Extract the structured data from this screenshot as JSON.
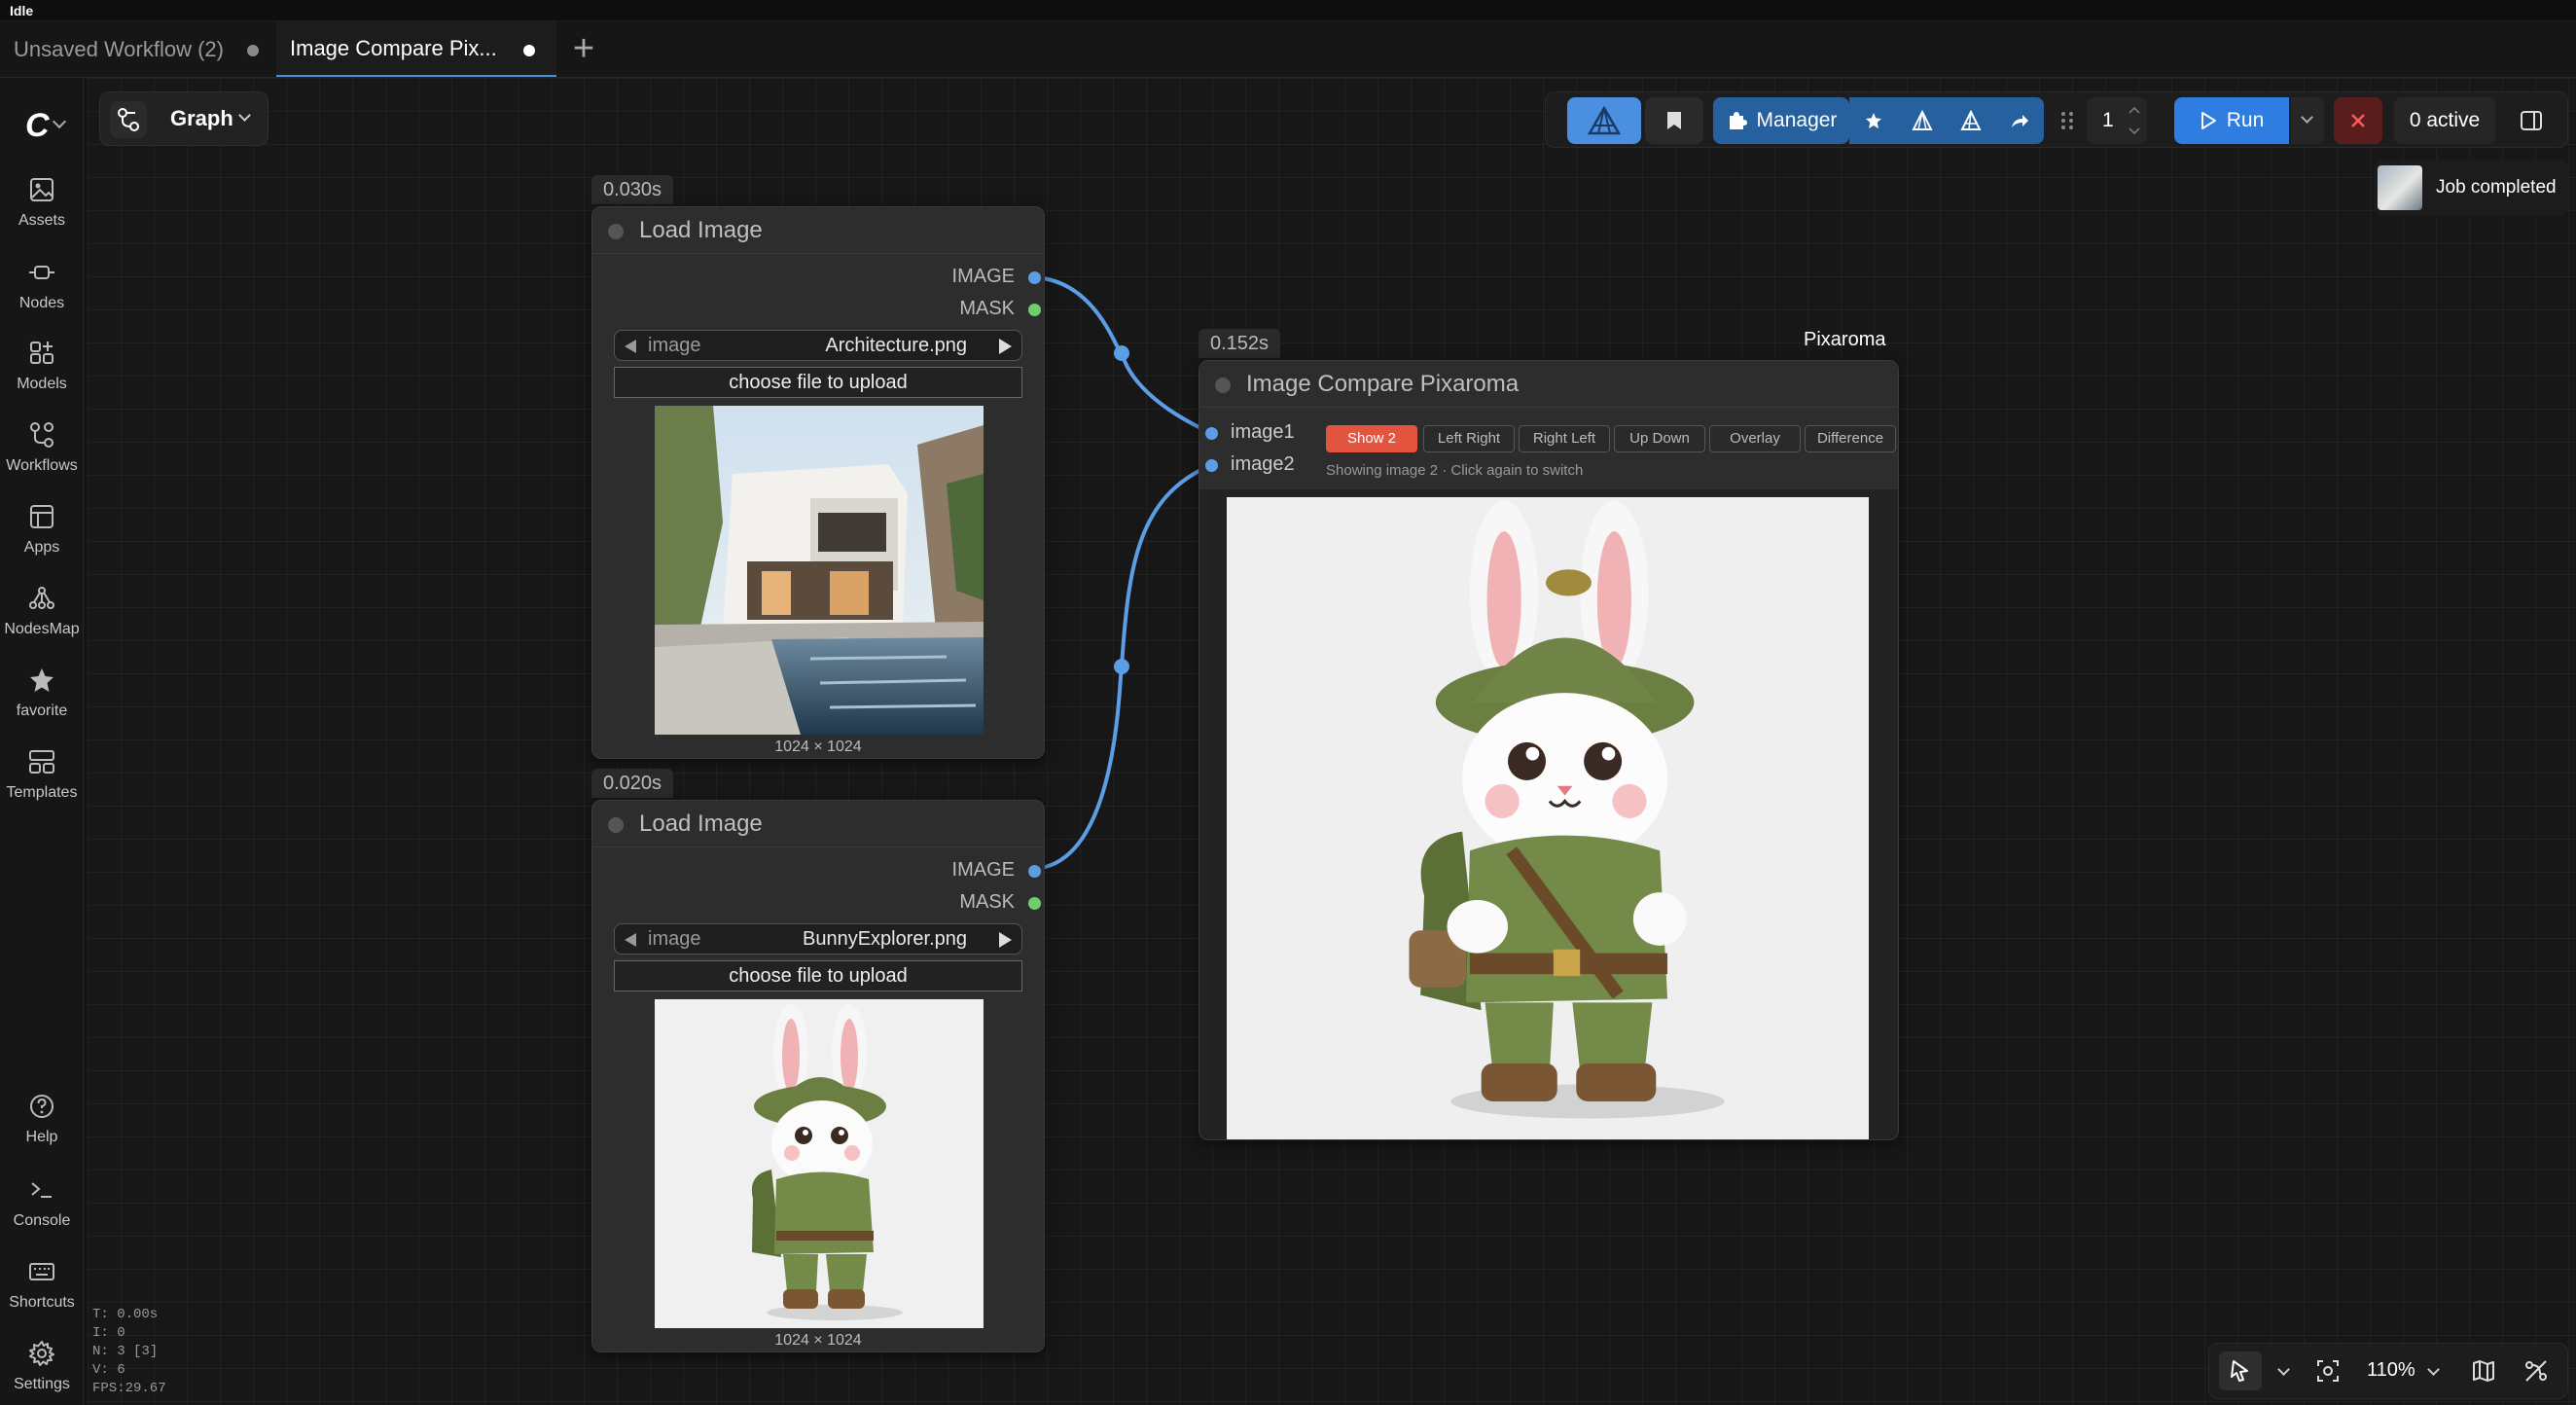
{
  "window": {
    "status": "Idle"
  },
  "tabs": [
    {
      "label": "Unsaved Workflow (2)",
      "active": false
    },
    {
      "label": "Image Compare Pix...",
      "active": true
    }
  ],
  "sidebar": {
    "items": [
      {
        "label": "Assets",
        "icon": "image-icon"
      },
      {
        "label": "Nodes",
        "icon": "node-icon"
      },
      {
        "label": "Models",
        "icon": "models-icon"
      },
      {
        "label": "Workflows",
        "icon": "workflow-icon"
      },
      {
        "label": "Apps",
        "icon": "apps-icon"
      },
      {
        "label": "NodesMap",
        "icon": "nodesmap-icon"
      },
      {
        "label": "favorite",
        "icon": "star-icon"
      },
      {
        "label": "Templates",
        "icon": "templates-icon"
      }
    ],
    "bottom_items": [
      {
        "label": "Help",
        "icon": "help-icon"
      },
      {
        "label": "Console",
        "icon": "console-icon"
      },
      {
        "label": "Shortcuts",
        "icon": "keyboard-icon"
      },
      {
        "label": "Settings",
        "icon": "gear-icon"
      }
    ]
  },
  "view_mode": {
    "label": "Graph"
  },
  "toolbar": {
    "manager_label": "Manager",
    "batch_count": "1",
    "run_label": "Run",
    "active_label": "0 active"
  },
  "notification": {
    "label": "Job completed"
  },
  "nodes": {
    "load1": {
      "timer": "0.030s",
      "title": "Load Image",
      "outputs": [
        "IMAGE",
        "MASK"
      ],
      "image_label": "image",
      "image_value": "Architecture.png",
      "upload_label": "choose file to upload",
      "dims": "1024 × 1024"
    },
    "load2": {
      "timer": "0.020s",
      "title": "Load Image",
      "outputs": [
        "IMAGE",
        "MASK"
      ],
      "image_label": "image",
      "image_value": "BunnyExplorer.png",
      "upload_label": "choose file to upload",
      "dims": "1024 × 1024"
    },
    "compare": {
      "timer": "0.152s",
      "badge": "Pixaroma",
      "title": "Image Compare Pixaroma",
      "inputs": [
        "image1",
        "image2"
      ],
      "buttons": [
        "Show 2",
        "Left Right",
        "Right Left",
        "Up Down",
        "Overlay",
        "Difference"
      ],
      "active_button": "Show 2",
      "status": "Showing image 2 · Click again to switch"
    }
  },
  "canvas_controls": {
    "zoom": "110%"
  },
  "stats": [
    "T: 0.00s",
    "I: 0",
    "N: 3 [3]",
    "V: 6",
    "FPS:29.67"
  ],
  "colors": {
    "link": "#5b9ee6",
    "accent": "#2f7de1",
    "active_button": "#e3553f",
    "mask_socket": "#6ccf6c"
  }
}
